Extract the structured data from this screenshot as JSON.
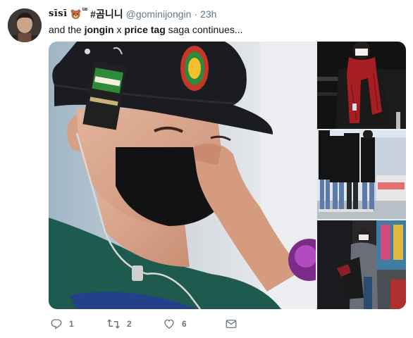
{
  "tweet": {
    "display_name": "sīsī",
    "badge_sup": "ᴳᴮ",
    "tag_name": "#곰니니",
    "handle": "@gominijongin",
    "separator": "·",
    "time": "23h",
    "text_pre": "and the ",
    "text_b1": "jongin",
    "text_mid": " x ",
    "text_b2": "price tag",
    "text_post": " saga continues..."
  },
  "actions": {
    "replies": "1",
    "retweets": "2",
    "likes": "6"
  },
  "colors": {
    "text": "#14171a",
    "muted": "#657786",
    "hat": "#1b1c22",
    "shirt": "#1f5a4f",
    "scarf": "#a61e22"
  },
  "icons": [
    "reply-icon",
    "retweet-icon",
    "like-icon",
    "dm-icon",
    "bear-emoji-icon"
  ]
}
